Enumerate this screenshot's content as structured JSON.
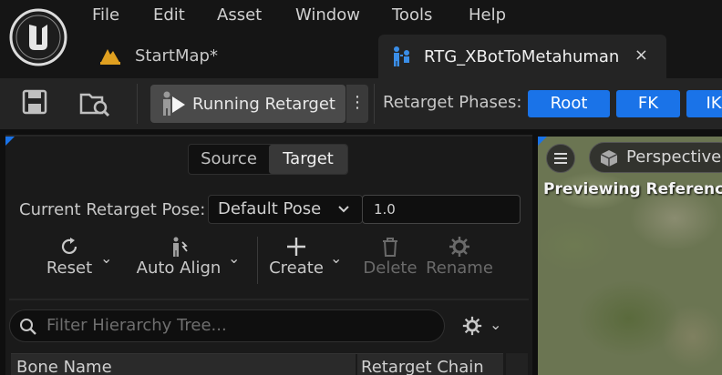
{
  "menu": {
    "items": [
      "File",
      "Edit",
      "Asset",
      "Window",
      "Tools",
      "Help"
    ]
  },
  "tabs": {
    "startmap": "StartMap*",
    "active": "RTG_XBotToMetahuman",
    "close": "×"
  },
  "toolbar": {
    "run_label": "Running Retarget",
    "more": "⋮",
    "phases_label": "Retarget Phases:",
    "phases": [
      "Root",
      "FK",
      "IK"
    ],
    "phase_color": "#1a73e8"
  },
  "left_panel": {
    "segmented": {
      "source": "Source",
      "target": "Target",
      "selected": "Target"
    },
    "pose_label": "Current Retarget Pose:",
    "pose_value": "Default Pose",
    "pose_blend": "1.0",
    "actions": {
      "reset": "Reset",
      "auto_align": "Auto Align",
      "create": "Create",
      "delete": "Delete",
      "rename": "Rename"
    },
    "filter_placeholder": "Filter Hierarchy Tree...",
    "columns": {
      "bone": "Bone Name",
      "chain": "Retarget Chain"
    }
  },
  "viewport": {
    "view_mode": "Perspective",
    "status": "Previewing Reference"
  }
}
